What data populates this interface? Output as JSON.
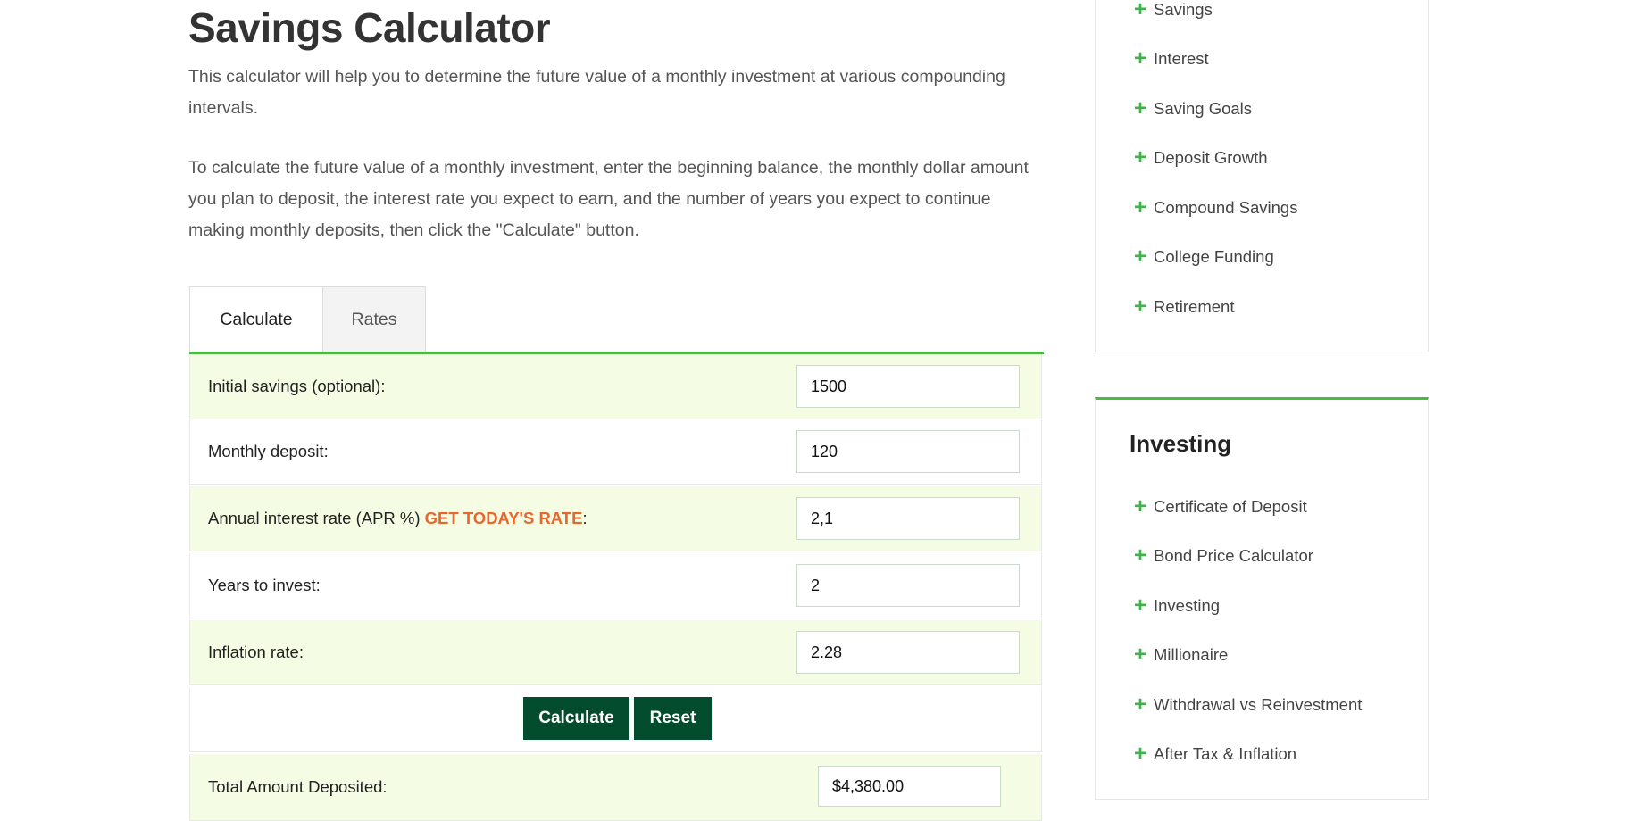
{
  "page": {
    "title": "Savings Calculator",
    "intro": "This calculator will help you to determine the future value of a monthly investment at various compounding intervals.",
    "instructions": "To calculate the future value of a monthly investment, enter the beginning balance, the monthly dollar amount you plan to deposit, the interest rate you expect to earn, and the number of years you expect to continue making monthly deposits, then click the \"Calculate\" button."
  },
  "tabs": [
    {
      "label": "Calculate",
      "active": true
    },
    {
      "label": "Rates",
      "active": false
    }
  ],
  "form": {
    "initial_savings": {
      "label": "Initial savings (optional):",
      "value": "1500"
    },
    "monthly_deposit": {
      "label": "Monthly deposit:",
      "value": "120"
    },
    "interest_rate": {
      "label": "Annual interest rate (APR %)",
      "link": "GET TODAY'S RATE",
      "suffix": ":",
      "value": "2,1"
    },
    "years": {
      "label": "Years to invest:",
      "value": "2"
    },
    "inflation": {
      "label": "Inflation rate:",
      "value": "2.28"
    },
    "calculate_label": "Calculate",
    "reset_label": "Reset",
    "total_deposited": {
      "label": "Total Amount Deposited:",
      "value": "$4,380.00"
    }
  },
  "sidebar": {
    "savings_items": [
      "Savings",
      "Interest",
      "Saving Goals",
      "Deposit Growth",
      "Compound Savings",
      "College Funding",
      "Retirement"
    ],
    "investing": {
      "heading": "Investing",
      "items": [
        "Certificate of Deposit",
        "Bond Price Calculator",
        "Investing",
        "Millionaire",
        "Withdrawal vs Reinvestment",
        "After Tax & Inflation"
      ]
    }
  },
  "colors": {
    "accent": "#4cb848",
    "button": "#034d2e",
    "link": "#e8672e",
    "row_highlight": "#f4fde4"
  }
}
